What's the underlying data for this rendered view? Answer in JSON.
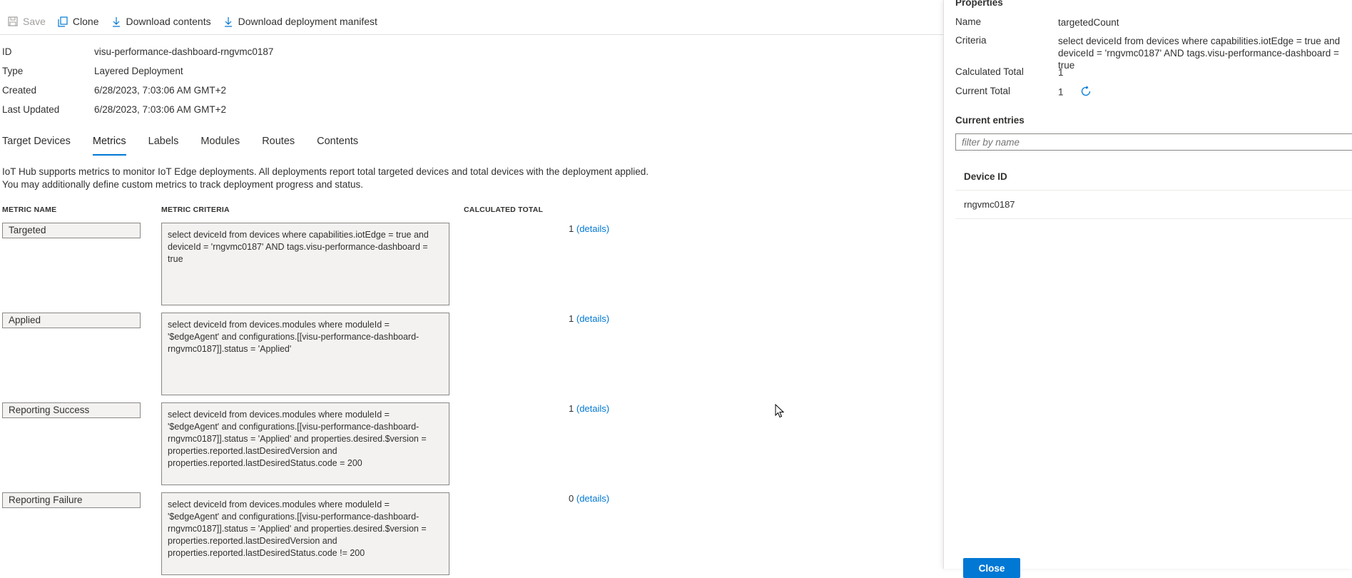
{
  "toolbar": {
    "save_label": "Save",
    "clone_label": "Clone",
    "download_contents_label": "Download contents",
    "download_manifest_label": "Download deployment manifest"
  },
  "details": {
    "id_key": "ID",
    "id_value": "visu-performance-dashboard-rngvmc0187",
    "type_key": "Type",
    "type_value": "Layered Deployment",
    "created_key": "Created",
    "created_value": "6/28/2023, 7:03:06 AM GMT+2",
    "updated_key": "Last Updated",
    "updated_value": "6/28/2023, 7:03:06 AM GMT+2"
  },
  "tabs": [
    {
      "label": "Target Devices"
    },
    {
      "label": "Metrics",
      "active": true
    },
    {
      "label": "Labels"
    },
    {
      "label": "Modules"
    },
    {
      "label": "Routes"
    },
    {
      "label": "Contents"
    }
  ],
  "description": {
    "line1": "IoT Hub supports metrics to monitor IoT Edge deployments. All deployments report total targeted devices and total devices with the deployment applied.",
    "line2": "You may additionally define custom metrics to track deployment progress and status."
  },
  "metrics_table": {
    "col_name": "METRIC NAME",
    "col_criteria": "METRIC CRITERIA",
    "col_total": "CALCULATED TOTAL",
    "details_label": "(details)",
    "rows": [
      {
        "name": "Targeted",
        "criteria": "select deviceId from devices where capabilities.iotEdge = true and deviceId = 'rngvmc0187' AND tags.visu-performance-dashboard = true",
        "total": "1"
      },
      {
        "name": "Applied",
        "criteria": "select deviceId from devices.modules where moduleId = '$edgeAgent' and configurations.[[visu-performance-dashboard-rngvmc0187]].status = 'Applied'",
        "total": "1"
      },
      {
        "name": "Reporting Success",
        "criteria": "select deviceId from devices.modules where moduleId = '$edgeAgent' and configurations.[[visu-performance-dashboard-rngvmc0187]].status = 'Applied' and properties.desired.$version = properties.reported.lastDesiredVersion and properties.reported.lastDesiredStatus.code = 200",
        "total": "1"
      },
      {
        "name": "Reporting Failure",
        "criteria": "select deviceId from devices.modules where moduleId = '$edgeAgent' and configurations.[[visu-performance-dashboard-rngvmc0187]].status = 'Applied' and properties.desired.$version = properties.reported.lastDesiredVersion and properties.reported.lastDesiredStatus.code != 200",
        "total": "0"
      }
    ]
  },
  "panel": {
    "title": "Properties",
    "name_key": "Name",
    "name_value": "targetedCount",
    "criteria_key": "Criteria",
    "criteria_value": "select deviceId from devices where capabilities.iotEdge = true and deviceId = 'rngvmc0187' AND tags.visu-performance-dashboard = true",
    "calc_total_key": "Calculated Total",
    "calc_total_value": "1",
    "current_total_key": "Current Total",
    "current_total_value": "1",
    "entries_title": "Current entries",
    "filter_placeholder": "filter by name",
    "device_id_header": "Device ID",
    "devices": [
      "rngvmc0187"
    ],
    "close_label": "Close"
  },
  "colors": {
    "accent": "#0078d4",
    "field_bg": "#f3f2f1",
    "border": "#8a8886"
  }
}
